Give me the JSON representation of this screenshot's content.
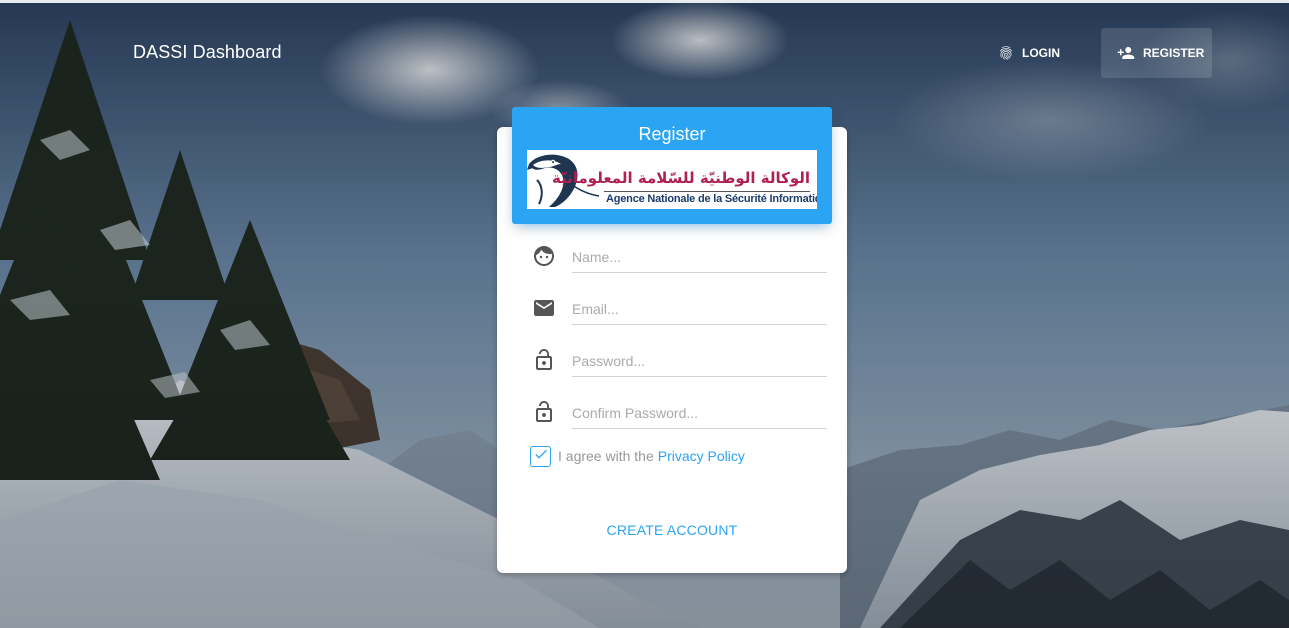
{
  "navbar": {
    "brand": "DASSI Dashboard",
    "login_label": "LOGIN",
    "register_label": "REGISTER"
  },
  "card": {
    "title": "Register",
    "logo": {
      "arabic_text": "الوكالة الوطنيّة للسّلامة المعلوماتيّة",
      "french_text": "Agence Nationale de la Sécurité Informatique"
    }
  },
  "form": {
    "name_placeholder": "Name...",
    "email_placeholder": "Email...",
    "password_placeholder": "Password...",
    "confirm_password_placeholder": "Confirm Password...",
    "agree_text": "I agree with the",
    "privacy_link": "Privacy Policy",
    "agree_checked": true,
    "submit_label": "CREATE ACCOUNT"
  },
  "icons": {
    "login": "fingerprint-icon",
    "register": "person-add-icon",
    "name": "face-icon",
    "email": "mail-icon",
    "password": "lock-icon",
    "confirm_password": "lock-icon",
    "checkbox": "check-icon"
  },
  "colors": {
    "accent": "#2ba4f4",
    "text_muted": "#999999",
    "logo_arabic": "#b02050",
    "logo_french": "#1a3c6e"
  }
}
